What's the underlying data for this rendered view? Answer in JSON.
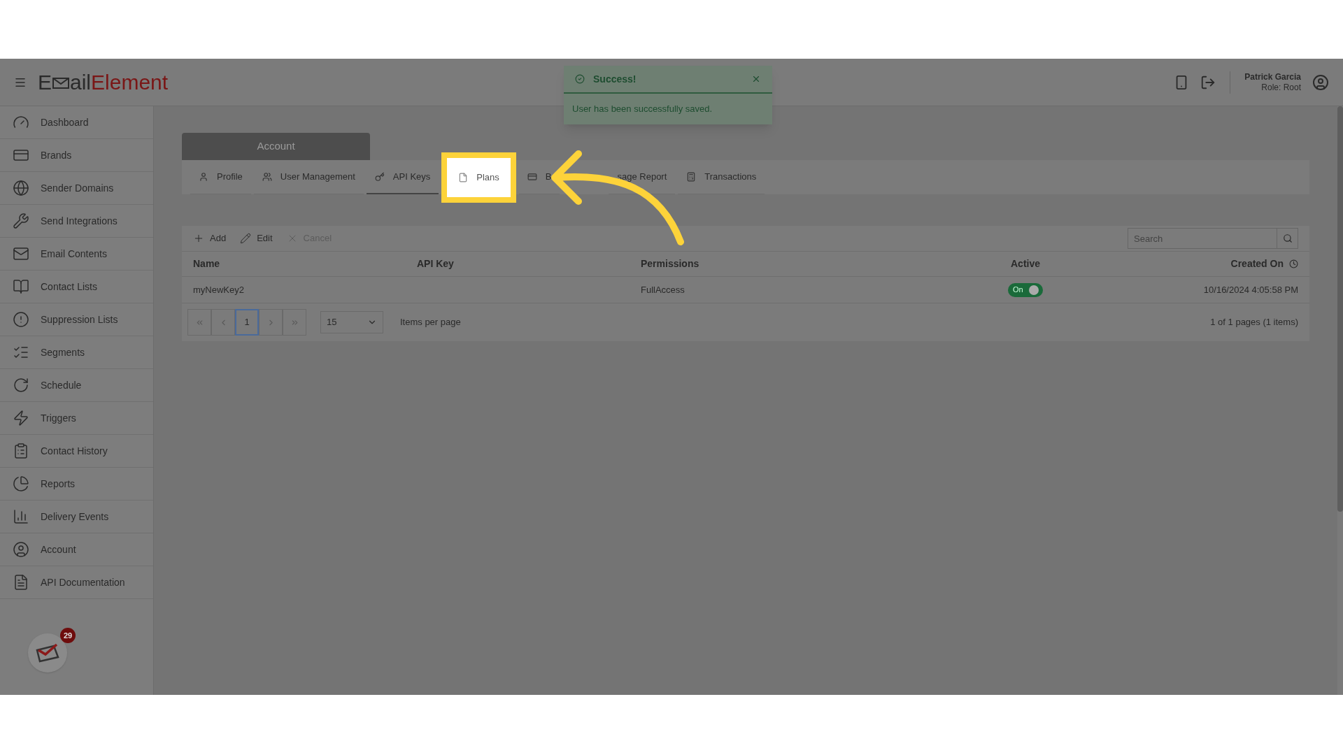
{
  "header": {
    "logo": {
      "part1": "E",
      "part2": "ail",
      "part3": "Element"
    },
    "user_name": "Patrick Garcia",
    "user_role": "Role: Root"
  },
  "toast": {
    "title": "Success!",
    "message": "User has been successfully saved."
  },
  "sidebar": {
    "items": [
      {
        "label": "Dashboard"
      },
      {
        "label": "Brands"
      },
      {
        "label": "Sender Domains"
      },
      {
        "label": "Send Integrations"
      },
      {
        "label": "Email Contents"
      },
      {
        "label": "Contact Lists"
      },
      {
        "label": "Suppression Lists"
      },
      {
        "label": "Segments"
      },
      {
        "label": "Schedule"
      },
      {
        "label": "Triggers"
      },
      {
        "label": "Contact History"
      },
      {
        "label": "Reports"
      },
      {
        "label": "Delivery Events"
      },
      {
        "label": "Account"
      },
      {
        "label": "API Documentation"
      }
    ],
    "notification_count": "29"
  },
  "page": {
    "title": "Account",
    "tabs": [
      {
        "label": "Profile",
        "selected": false,
        "highlighted": false
      },
      {
        "label": "User Management",
        "selected": false,
        "highlighted": false
      },
      {
        "label": "API Keys",
        "selected": true,
        "highlighted": false
      },
      {
        "label": "Plans",
        "selected": false,
        "highlighted": true
      },
      {
        "label": "B",
        "selected": false,
        "highlighted": false
      },
      {
        "label": "sage Report",
        "selected": false,
        "highlighted": false
      },
      {
        "label": "Transactions",
        "selected": false,
        "highlighted": false
      }
    ],
    "toolbar": [
      {
        "label": "Add",
        "disabled": false
      },
      {
        "label": "Edit",
        "disabled": false
      },
      {
        "label": "Cancel",
        "disabled": true
      }
    ],
    "search": {
      "placeholder": "Search"
    },
    "table": {
      "columns": [
        "Name",
        "API Key",
        "Permissions",
        "Active",
        "Created On"
      ],
      "rows": [
        {
          "name": "myNewKey2",
          "permissions": "FullAccess",
          "active": {
            "label": "On",
            "on": true
          },
          "created_on": "10/16/2024 4:05:58 PM"
        }
      ]
    },
    "pager": {
      "current": "1",
      "page_size": "15",
      "page_size_label": "Items per page",
      "summary": "1 of 1 pages (1 items)"
    }
  }
}
